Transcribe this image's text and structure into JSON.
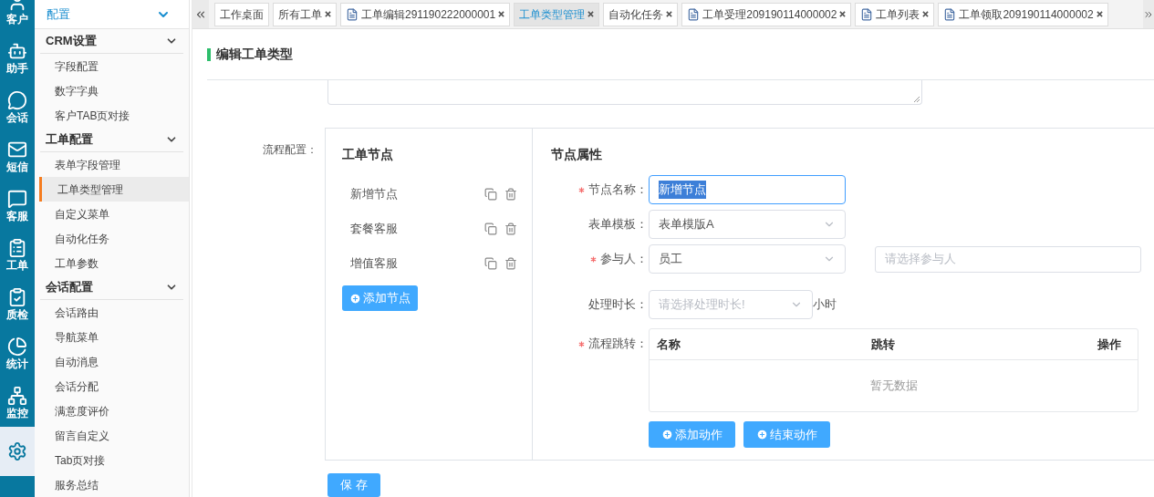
{
  "rail": [
    {
      "label": "客户",
      "selected": false
    },
    {
      "label": "助手",
      "selected": false
    },
    {
      "label": "会话",
      "selected": false
    },
    {
      "label": "短信",
      "selected": false
    },
    {
      "label": "客服",
      "selected": false
    },
    {
      "label": "工单",
      "selected": false
    },
    {
      "label": "质检",
      "selected": false
    },
    {
      "label": "统计",
      "selected": false
    },
    {
      "label": "监控",
      "selected": false
    },
    {
      "selected": true
    }
  ],
  "sidebar": {
    "header": "配置",
    "groups": [
      {
        "title": "CRM设置",
        "expanded": true,
        "items": [
          {
            "label": "字段配置",
            "selected": false
          },
          {
            "label": "数字字典",
            "selected": false
          },
          {
            "label": "客户TAB页对接",
            "selected": false
          }
        ]
      },
      {
        "title": "工单配置",
        "expanded": true,
        "items": [
          {
            "label": "表单字段管理",
            "selected": false
          },
          {
            "label": "工单类型管理",
            "selected": true
          },
          {
            "label": "自定义菜单",
            "selected": false
          },
          {
            "label": "自动化任务",
            "selected": false
          },
          {
            "label": "工单参数",
            "selected": false
          }
        ]
      },
      {
        "title": "会话配置",
        "expanded": true,
        "items": [
          {
            "label": "会话路由",
            "selected": false
          },
          {
            "label": "导航菜单",
            "selected": false
          },
          {
            "label": "自动消息",
            "selected": false
          },
          {
            "label": "会话分配",
            "selected": false
          },
          {
            "label": "满意度评价",
            "selected": false
          },
          {
            "label": "留言自定义",
            "selected": false
          },
          {
            "label": "Tab页对接",
            "selected": false
          },
          {
            "label": "服务总结",
            "selected": false
          }
        ]
      }
    ]
  },
  "tabs": [
    {
      "label": "工作桌面",
      "selected": false,
      "closable": false,
      "kind": "plain"
    },
    {
      "label": "所有工单",
      "selected": false,
      "closable": true,
      "kind": "plain"
    },
    {
      "label": "工单编辑291190222000001",
      "selected": false,
      "closable": true,
      "kind": "document"
    },
    {
      "label": "工单类型管理",
      "selected": true,
      "closable": true,
      "kind": "plain"
    },
    {
      "label": "自动化任务",
      "selected": false,
      "closable": true,
      "kind": "plain"
    },
    {
      "label": "工单受理209190114000002",
      "selected": false,
      "closable": true,
      "kind": "document"
    },
    {
      "label": "工单列表",
      "selected": false,
      "closable": true,
      "kind": "document"
    },
    {
      "label": "工单领取209190114000002",
      "selected": false,
      "closable": true,
      "kind": "document"
    }
  ],
  "page_title": "编辑工单类型",
  "flow": {
    "label": "流程配置：",
    "nodes": {
      "title": "工单节点",
      "items": [
        {
          "label": "新增节点"
        },
        {
          "label": "套餐客服"
        },
        {
          "label": "增值客服"
        }
      ],
      "add_button": "添加节点"
    },
    "properties": {
      "title": "节点属性",
      "fields": [
        {
          "kind": "text",
          "label": "节点名称：",
          "required": true,
          "value": "新增节点"
        },
        {
          "kind": "select",
          "label": "表单模板：",
          "required": false,
          "value": "表单模版A"
        },
        {
          "kind": "select",
          "label": "参与人：",
          "required": true,
          "value": "员工",
          "extra_placeholder": "请选择参与人"
        },
        {
          "kind": "select",
          "label": "处理时长：",
          "required": false,
          "placeholder": "请选择处理时长!",
          "suffix": "小时"
        }
      ],
      "transitions": {
        "label": "流程跳转：",
        "required": true,
        "columns": [
          "名称",
          "跳转",
          "操作"
        ],
        "empty_text": "暂无数据"
      },
      "buttons": [
        "添加动作",
        "结束动作"
      ]
    }
  },
  "save_button": "保 存"
}
